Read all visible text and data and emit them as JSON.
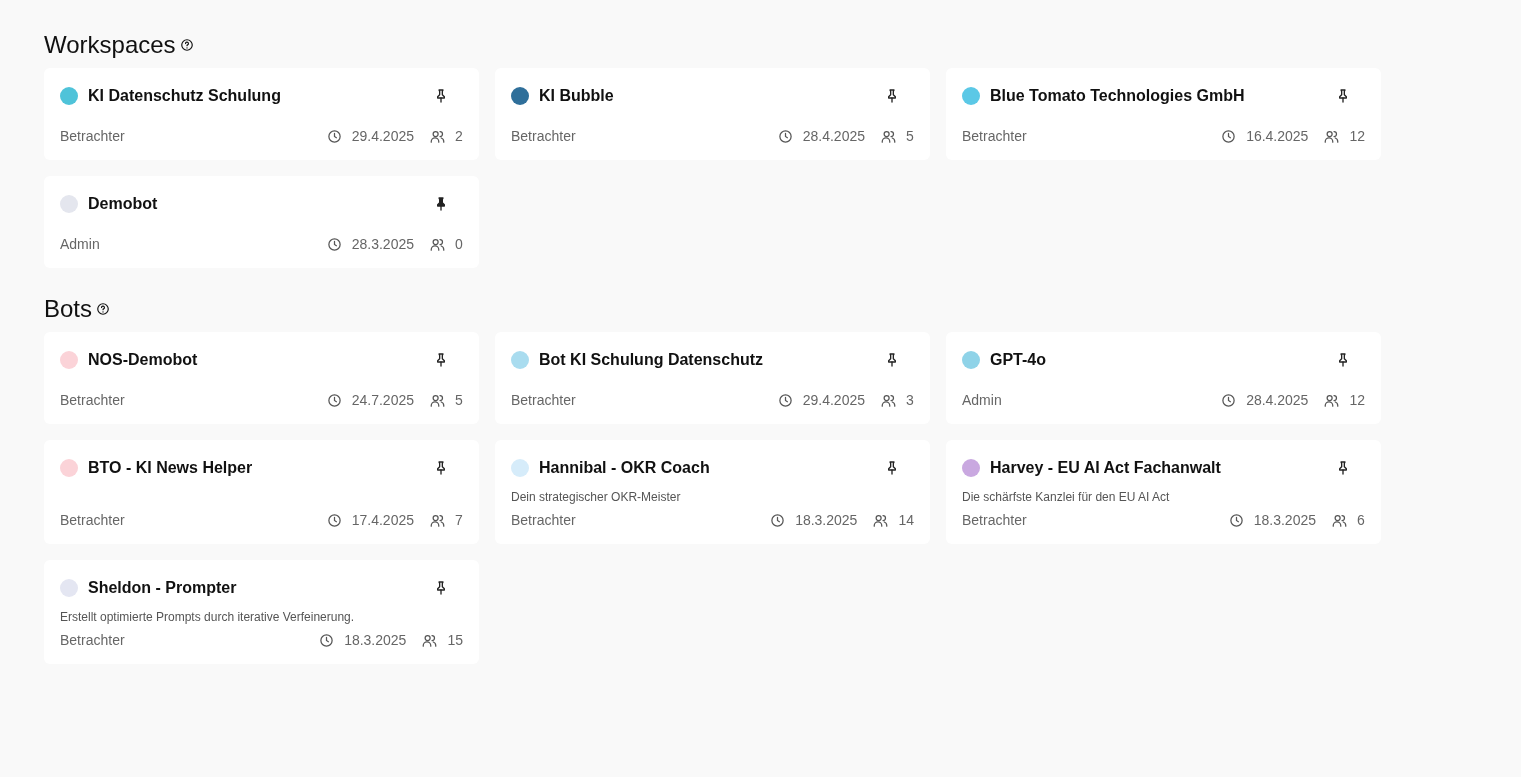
{
  "sections": [
    {
      "title": "Workspaces",
      "cards": [
        {
          "name": "KI Datenschutz Schulung",
          "color": "#4fc3d9",
          "pinned": false,
          "role": "Betrachter",
          "date": "29.4.2025",
          "members": "2"
        },
        {
          "name": "KI Bubble",
          "color": "#2f6f9a",
          "pinned": false,
          "role": "Betrachter",
          "date": "28.4.2025",
          "members": "5"
        },
        {
          "name": "Blue Tomato Technologies GmbH",
          "color": "#5bc8e6",
          "pinned": false,
          "role": "Betrachter",
          "date": "16.4.2025",
          "members": "12"
        },
        {
          "name": "Demobot",
          "color": "#e4e6ee",
          "pinned": true,
          "role": "Admin",
          "date": "28.3.2025",
          "members": "0"
        }
      ]
    },
    {
      "title": "Bots",
      "cards": [
        {
          "name": "NOS-Demobot",
          "color": "#fbd3d8",
          "pinned": false,
          "role": "Betrachter",
          "date": "24.7.2025",
          "members": "5"
        },
        {
          "name": "Bot KI Schulung Datenschutz",
          "color": "#a9dcef",
          "pinned": false,
          "role": "Betrachter",
          "date": "29.4.2025",
          "members": "3"
        },
        {
          "name": "GPT-4o",
          "color": "#8fd3e8",
          "pinned": false,
          "role": "Admin",
          "date": "28.4.2025",
          "members": "12"
        },
        {
          "name": "BTO - KI News Helper",
          "color": "#fbd3d8",
          "pinned": false,
          "role": "Betrachter",
          "date": "17.4.2025",
          "members": "7"
        },
        {
          "name": "Hannibal - OKR Coach",
          "color": "#d6ecfa",
          "pinned": false,
          "description": "Dein strategischer OKR-Meister",
          "role": "Betrachter",
          "date": "18.3.2025",
          "members": "14"
        },
        {
          "name": "Harvey - EU AI Act Fachanwalt",
          "color": "#c9a8e0",
          "pinned": false,
          "description": "Die schärfste Kanzlei für den EU AI Act",
          "role": "Betrachter",
          "date": "18.3.2025",
          "members": "6"
        },
        {
          "name": "Sheldon - Prompter",
          "color": "#e4e6f2",
          "pinned": false,
          "description": "Erstellt optimierte Prompts durch iterative Verfeinerung.",
          "role": "Betrachter",
          "date": "18.3.2025",
          "members": "15"
        }
      ]
    }
  ]
}
